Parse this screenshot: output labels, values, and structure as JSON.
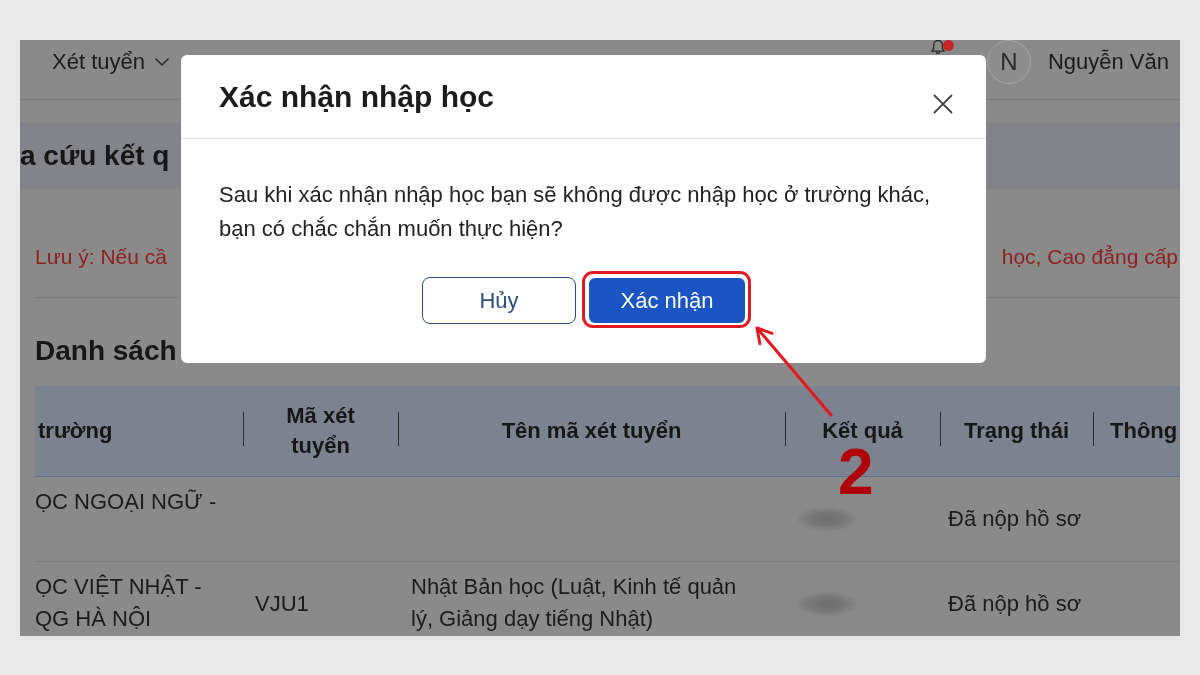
{
  "top_nav": {
    "menu_item": {
      "label": "Xét tuyển",
      "dropdown": true
    },
    "notifications": {
      "unread": true
    },
    "user": {
      "initial": "N",
      "name": "Nguyễn Văn"
    }
  },
  "page_title": "a cứu kết q",
  "notice": {
    "left_part": "Lưu ý: Nếu cầ",
    "right_part": "học, Cao đẳng cấp"
  },
  "section_title": "Danh sách",
  "table": {
    "columns": [
      "trường",
      "Mã xét tuyển",
      "Tên mã xét tuyển",
      "Kết quả",
      "Trạng thái",
      "Thông"
    ],
    "rows": [
      {
        "school_name": "ỌC NGOẠI NGỮ -",
        "result_blurred": true,
        "status": "Đã nộp hồ sơ"
      },
      {
        "school_name": "ỌC VIỆT NHẬT - QG HÀ NỘI",
        "admission_code": "VJU1",
        "program_name": "Nhật Bản học (Luật, Kinh tế quản lý, Giảng dạy tiếng Nhật)",
        "result_blurred": true,
        "status": "Đã nộp hồ sơ"
      }
    ]
  },
  "dialog": {
    "title": "Xác nhận nhập học",
    "message": "Sau khi xác nhận nhập học bạn sẽ không được nhập học ở trường khác, bạn có chắc chắn muốn thực hiện?",
    "buttons": [
      {
        "label": "Hủy",
        "kind": "secondary",
        "highlighted": false
      },
      {
        "label": "Xác nhận",
        "kind": "primary",
        "highlighted": true
      }
    ]
  },
  "annotation": {
    "step": "2"
  }
}
